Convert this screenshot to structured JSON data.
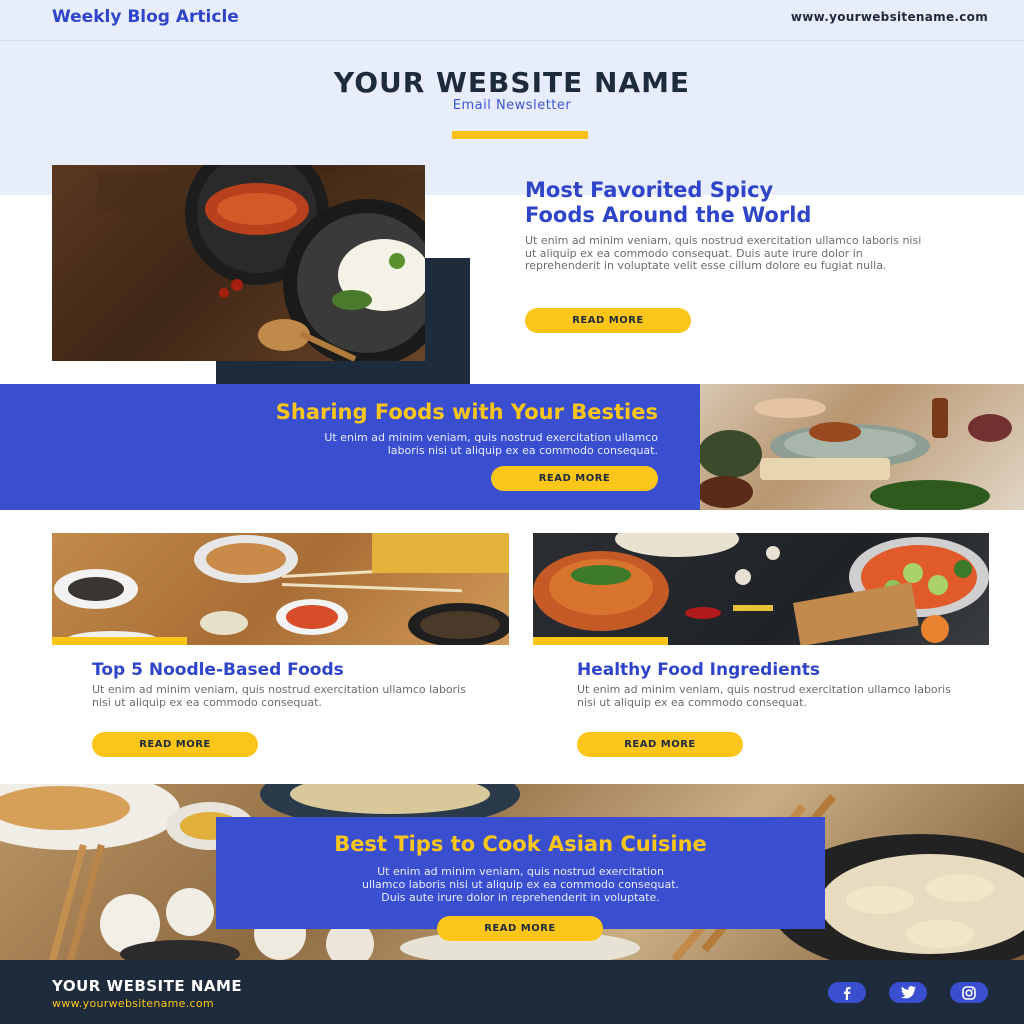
{
  "header": {
    "blog_tag": "Weekly Blog Article",
    "site_url": "www.yourwebsitename.com",
    "site_name": "YOUR WEBSITE NAME",
    "subtitle": "Email Newsletter"
  },
  "articles": [
    {
      "title_line1": "Most Favorited Spicy",
      "title_line2": "Foods Around the World",
      "body": "Ut enim ad minim veniam, quis nostrud exercitation ullamco laboris nisi ut aliquip ex ea commodo consequat. Duis aute irure dolor in reprehenderit in voluptate velit esse cillum dolore eu fugiat nulla.",
      "button": "READ MORE"
    },
    {
      "title": "Sharing Foods with Your Besties",
      "body_line1": "Ut enim ad minim veniam, quis nostrud exercitation ullamco",
      "body_line2": "laboris nisi ut aliquip ex ea commodo consequat.",
      "button": "READ MORE"
    },
    {
      "title": "Top 5 Noodle-Based Foods",
      "body": "Ut enim ad minim veniam, quis nostrud exercitation ullamco laboris nisi ut aliquip ex ea commodo consequat.",
      "button": "READ MORE"
    },
    {
      "title": "Healthy Food Ingredients",
      "body": "Ut enim ad minim veniam, quis nostrud exercitation ullamco laboris nisi ut aliquip ex ea commodo consequat.",
      "button": "READ MORE"
    },
    {
      "title": "Best Tips to Cook Asian Cuisine",
      "body_line1": "Ut enim ad minim veniam, quis nostrud exercitation",
      "body_line2": "ullamco laboris nisi ut aliquip ex ea commodo consequat.",
      "body_line3": "Duis aute irure dolor in reprehenderit in voluptate.",
      "button": "READ MORE"
    }
  ],
  "footer": {
    "site_name": "YOUR WEBSITE NAME",
    "site_url": "www.yourwebsitename.com",
    "social": [
      "facebook-icon",
      "twitter-icon",
      "instagram-icon"
    ]
  },
  "colors": {
    "primary_blue": "#3a4fd0",
    "accent_yellow": "#fcc51a",
    "navy": "#1e2b3c",
    "header_bg": "#e8edfb"
  }
}
